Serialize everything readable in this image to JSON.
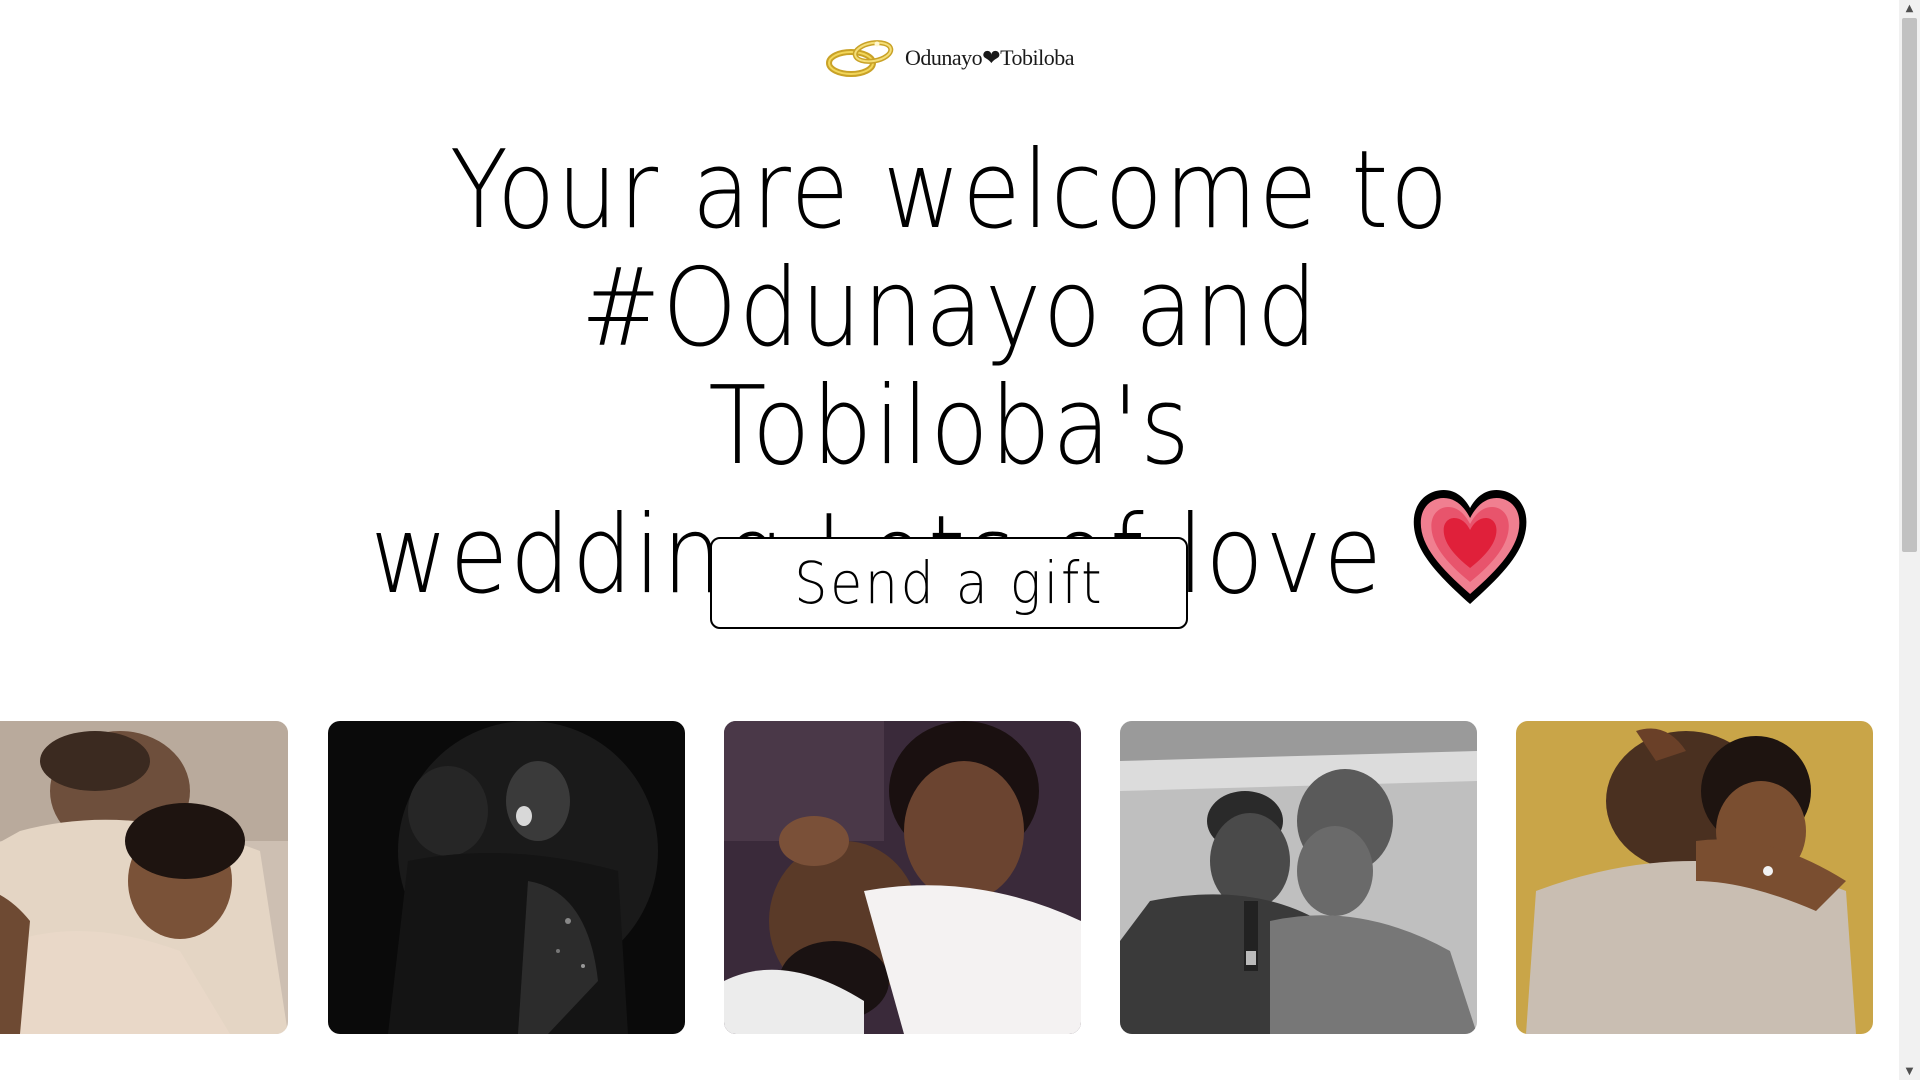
{
  "header": {
    "logo_text": "Odunayo❤Tobiloba",
    "logo_icon": "wedding-rings-icon"
  },
  "hero": {
    "line1": "Your are welcome to",
    "line2": "#Odunayo and Tobiloba's",
    "line3": "wedding Lots of love",
    "emoji": "heart-icon"
  },
  "cta": {
    "gift_label": "Send a gift"
  },
  "gallery": {
    "photos": [
      {
        "alt": "couple-photo-1",
        "tone": "warm-beige"
      },
      {
        "alt": "couple-photo-2",
        "tone": "black-and-white-dark"
      },
      {
        "alt": "couple-photo-3",
        "tone": "color-purple-white"
      },
      {
        "alt": "couple-photo-4",
        "tone": "black-and-white"
      },
      {
        "alt": "couple-photo-5",
        "tone": "color-mustard"
      }
    ]
  },
  "colors": {
    "text": "#000000",
    "background": "#ffffff",
    "heart_outer": "#e8546c",
    "heart_inner": "#e8203a",
    "ring_gold": "#d4b030"
  }
}
